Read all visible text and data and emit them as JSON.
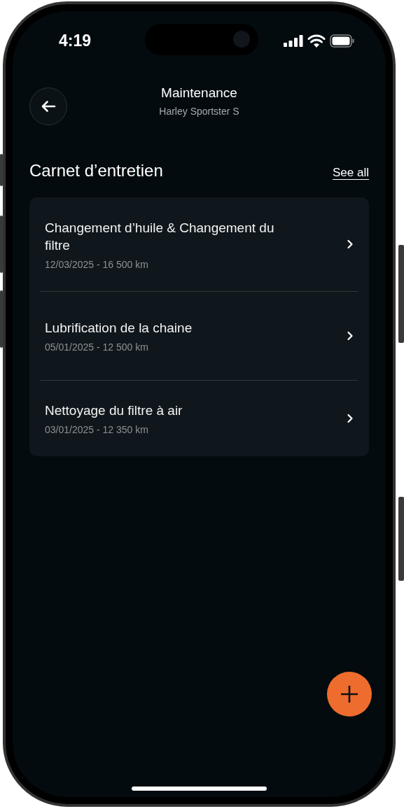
{
  "status_bar": {
    "time": "4:19"
  },
  "header": {
    "title": "Maintenance",
    "subtitle": "Harley Sportster S"
  },
  "section": {
    "title": "Carnet d’entretien",
    "link": "See all"
  },
  "entries": [
    {
      "title": "Changement d’huile & Changement du filtre",
      "meta": "12/03/2025 - 16 500 km"
    },
    {
      "title": "Lubrification de la chaine",
      "meta": "05/01/2025 - 12 500 km"
    },
    {
      "title": "Nettoyage du filtre à air",
      "meta": "03/01/2025 - 12 350 km"
    }
  ]
}
